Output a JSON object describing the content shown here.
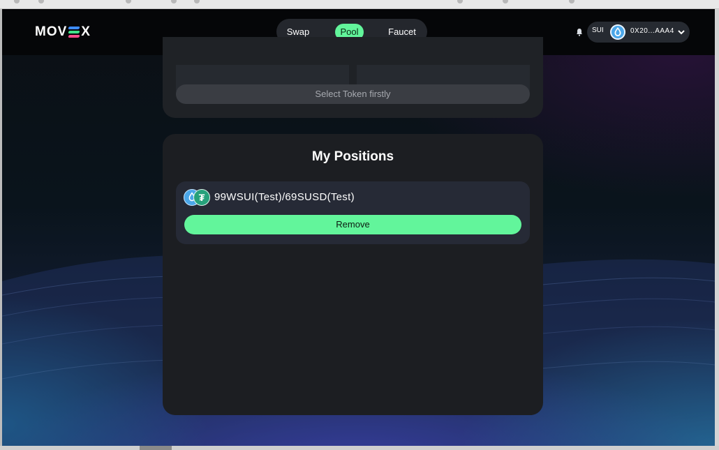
{
  "app": {
    "logo": {
      "left": "MOV",
      "right": "X"
    },
    "nav": [
      {
        "label": "Swap",
        "active": false
      },
      {
        "label": "Pool",
        "active": true
      },
      {
        "label": "Faucet",
        "active": false
      }
    ],
    "wallet": {
      "network": "SUI",
      "address": "0X20...AAA4"
    }
  },
  "add_liquidity": {
    "select_token_label": "Select Token firstly"
  },
  "positions": {
    "title": "My Positions",
    "items": [
      {
        "token_a_icon": "sui-drop-icon",
        "token_b_icon": "tether-icon",
        "token_b_glyph": "₮",
        "pair": "99WSUI(Test)/69SUSD(Test)",
        "remove_label": "Remove"
      }
    ]
  },
  "colors": {
    "accent": "#62f59b",
    "card": "#1c1e22",
    "header": "#050608"
  }
}
